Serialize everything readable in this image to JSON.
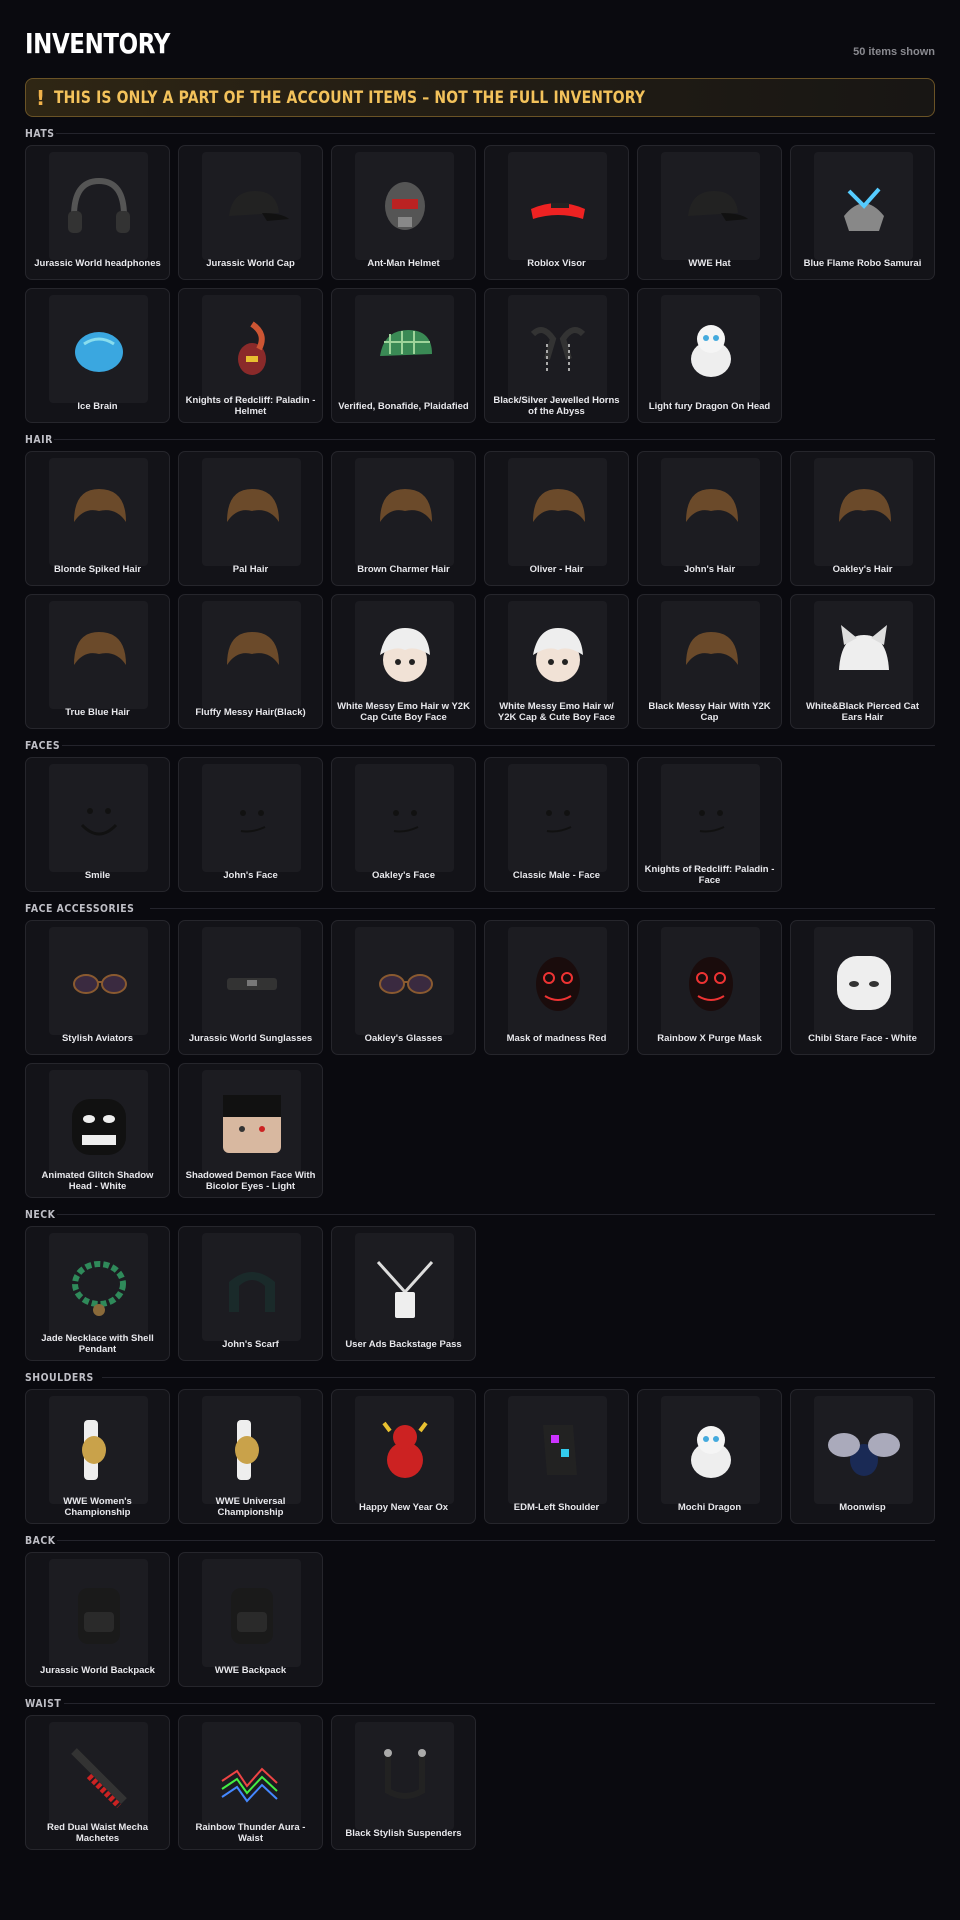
{
  "header": {
    "title": "INVENTORY",
    "count": "50 items shown"
  },
  "warning": {
    "icon": "!",
    "text": "THIS IS ONLY A PART OF THE ACCOUNT ITEMS – NOT THE FULL INVENTORY"
  },
  "sections": [
    {
      "label": "HATS",
      "items": [
        {
          "name": "Jurassic World headphones",
          "icon": "headphones-icon"
        },
        {
          "name": "Jurassic World Cap",
          "icon": "cap-icon"
        },
        {
          "name": "Ant-Man Helmet",
          "icon": "helmet-icon"
        },
        {
          "name": "Roblox Visor",
          "icon": "visor-icon"
        },
        {
          "name": "WWE Hat",
          "icon": "cap-icon"
        },
        {
          "name": "Blue Flame Robo Samurai",
          "icon": "samurai-helmet-icon"
        },
        {
          "name": "Ice Brain",
          "icon": "brain-icon"
        },
        {
          "name": "Knights of Redcliff: Paladin - Helmet",
          "icon": "knight-helmet-icon"
        },
        {
          "name": "Verified, Bonafide, Plaidafied",
          "icon": "plaid-cap-icon"
        },
        {
          "name": "Black/Silver Jewelled Horns of the Abyss",
          "icon": "horns-icon"
        },
        {
          "name": "Light fury Dragon On Head",
          "icon": "dragon-icon"
        }
      ]
    },
    {
      "label": "HAIR",
      "items": [
        {
          "name": "Blonde Spiked Hair",
          "icon": "hair-icon"
        },
        {
          "name": "Pal Hair",
          "icon": "hair-icon"
        },
        {
          "name": "Brown Charmer Hair",
          "icon": "hair-icon"
        },
        {
          "name": "Oliver - Hair",
          "icon": "hair-icon"
        },
        {
          "name": "John's Hair",
          "icon": "hair-icon"
        },
        {
          "name": "Oakley's Hair",
          "icon": "hair-icon"
        },
        {
          "name": "True Blue Hair",
          "icon": "hair-icon"
        },
        {
          "name": "Fluffy Messy Hair(Black)",
          "icon": "hair-icon"
        },
        {
          "name": "White Messy Emo Hair w Y2K Cap Cute Boy Face",
          "icon": "head-icon"
        },
        {
          "name": "White Messy Emo Hair w/ Y2K Cap & Cute Boy Face",
          "icon": "head-icon"
        },
        {
          "name": "Black Messy Hair With Y2K Cap",
          "icon": "hair-icon"
        },
        {
          "name": "White&Black Pierced Cat Ears Hair",
          "icon": "cat-ears-hair-icon"
        }
      ]
    },
    {
      "label": "FACES",
      "items": [
        {
          "name": "Smile",
          "icon": "smile-face-icon"
        },
        {
          "name": "John's Face",
          "icon": "face-icon"
        },
        {
          "name": "Oakley's Face",
          "icon": "face-icon"
        },
        {
          "name": "Classic Male - Face",
          "icon": "face-icon"
        },
        {
          "name": "Knights of Redcliff: Paladin - Face",
          "icon": "face-icon"
        }
      ]
    },
    {
      "label": "FACE ACCESSORIES",
      "items": [
        {
          "name": "Stylish Aviators",
          "icon": "glasses-icon"
        },
        {
          "name": "Jurassic World Sunglasses",
          "icon": "sunglasses-icon"
        },
        {
          "name": "Oakley's Glasses",
          "icon": "glasses-icon"
        },
        {
          "name": "Mask of madness Red",
          "icon": "mask-icon"
        },
        {
          "name": "Rainbow X Purge Mask",
          "icon": "mask-icon"
        },
        {
          "name": "Chibi Stare Face - White",
          "icon": "chibi-head-icon"
        },
        {
          "name": "Animated Glitch Shadow Head - White",
          "icon": "shadow-head-icon"
        },
        {
          "name": "Shadowed Demon Face With Bicolor Eyes - Light",
          "icon": "demon-face-icon"
        }
      ]
    },
    {
      "label": "NECK",
      "items": [
        {
          "name": "Jade Necklace with Shell Pendant",
          "icon": "necklace-icon"
        },
        {
          "name": "John's Scarf",
          "icon": "scarf-icon"
        },
        {
          "name": "User Ads Backstage Pass",
          "icon": "lanyard-icon"
        }
      ]
    },
    {
      "label": "SHOULDERS",
      "items": [
        {
          "name": "WWE Women's Championship",
          "icon": "belt-icon"
        },
        {
          "name": "WWE Universal Championship",
          "icon": "belt-icon"
        },
        {
          "name": "Happy New Year Ox",
          "icon": "ox-icon"
        },
        {
          "name": "EDM-Left Shoulder",
          "icon": "shoulder-icon"
        },
        {
          "name": "Mochi Dragon",
          "icon": "dragon-icon"
        },
        {
          "name": "Moonwisp",
          "icon": "moth-icon"
        }
      ]
    },
    {
      "label": "BACK",
      "items": [
        {
          "name": "Jurassic World Backpack",
          "icon": "backpack-icon"
        },
        {
          "name": "WWE Backpack",
          "icon": "backpack-icon"
        }
      ]
    },
    {
      "label": "WAIST",
      "items": [
        {
          "name": "Red Dual Waist Mecha Machetes",
          "icon": "machete-icon"
        },
        {
          "name": "Rainbow Thunder Aura - Waist",
          "icon": "aura-icon"
        },
        {
          "name": "Black Stylish Suspenders",
          "icon": "suspenders-icon"
        }
      ]
    }
  ]
}
